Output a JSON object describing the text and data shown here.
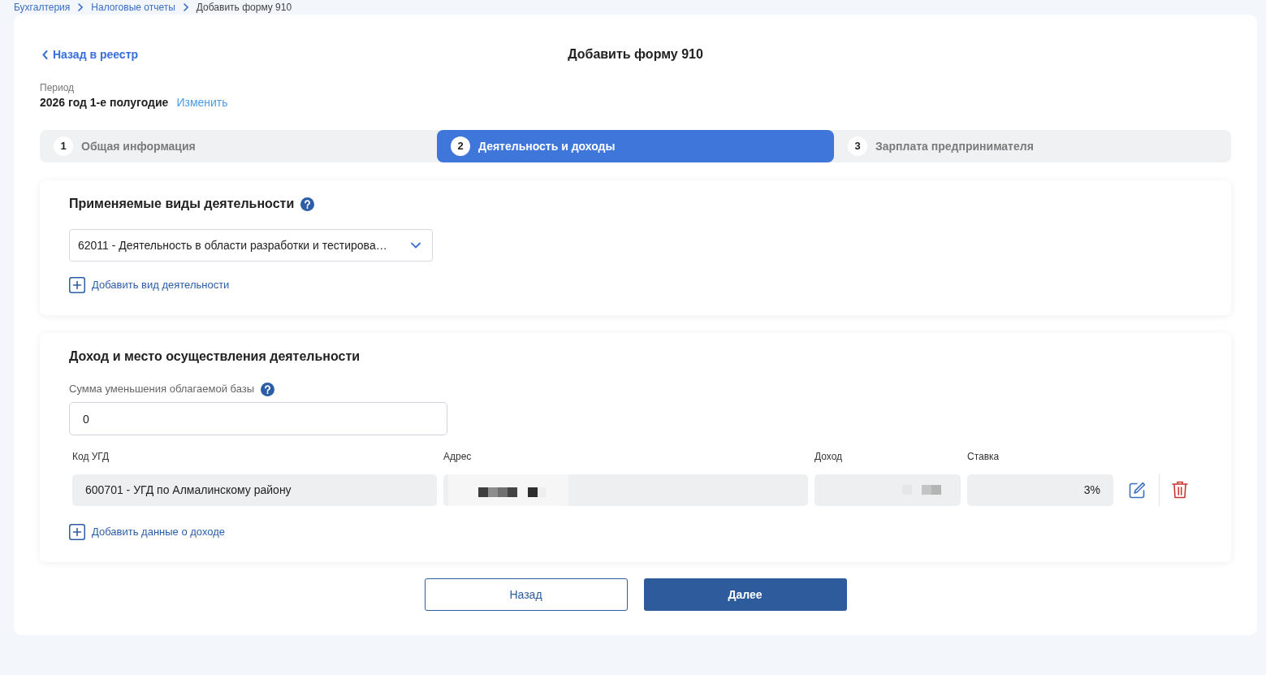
{
  "breadcrumbs": [
    {
      "label": "Бухгалтерия"
    },
    {
      "label": "Налоговые отчеты"
    },
    {
      "label": "Добавить форму 910"
    }
  ],
  "back_link": "Назад в реестр",
  "title": "Добавить форму 910",
  "period": {
    "label": "Период",
    "value": "2026 год 1-е полугодие",
    "change_link": "Изменить"
  },
  "steps": [
    {
      "number": "1",
      "label": "Общая информация",
      "selected": false
    },
    {
      "number": "2",
      "label": "Деятельность и доходы",
      "selected": true
    },
    {
      "number": "3",
      "label": "Зарплата предпринимателя",
      "selected": false
    }
  ],
  "activities_section": {
    "title": "Применяемые виды деятельности",
    "activity_select": {
      "value": "62011 - Деятельность в области разработки и тестирова…"
    },
    "add_link": "Добавить вид деятельности"
  },
  "income_section": {
    "title": "Доход и место осуществления деятельности",
    "reduction_field": {
      "label": "Сумма уменьшения облагаемой базы",
      "value": "0"
    },
    "columns": [
      "Код УГД",
      "Адрес",
      "Доход",
      "Ставка"
    ],
    "rows": [
      {
        "ugd_code": "600701 - УГД по Алмалинскому району",
        "rate": "3%"
      }
    ],
    "add_link": "Добавить данные о доходе"
  },
  "buttons": [
    {
      "label": "Назад",
      "kind": "secondary"
    },
    {
      "label": "Далее",
      "kind": "primary"
    }
  ]
}
